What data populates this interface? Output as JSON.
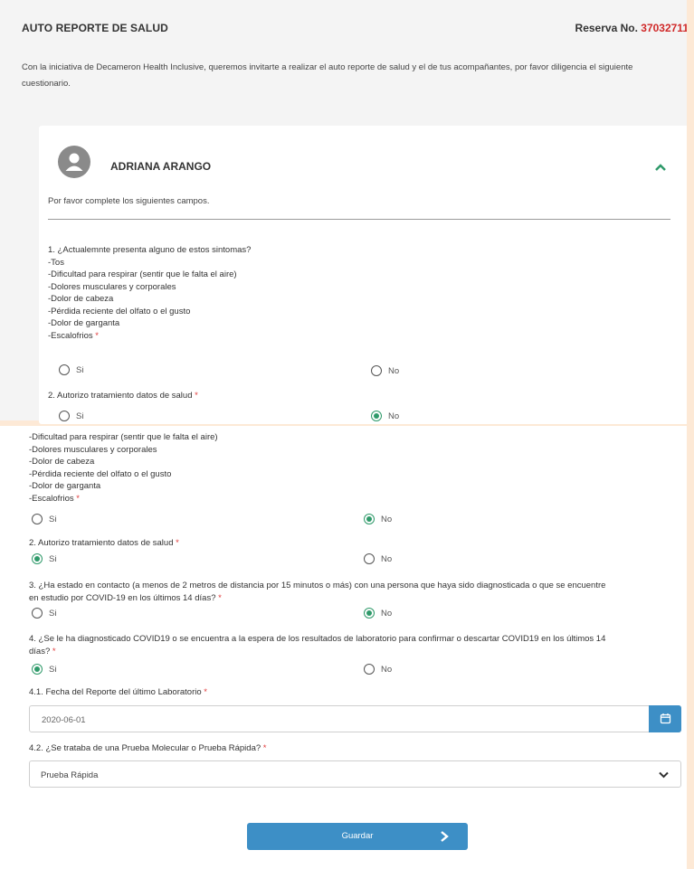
{
  "header": {
    "title": "AUTO REPORTE DE SALUD",
    "reserva_label": "Reserva No.",
    "reserva_number": "37032711"
  },
  "intro": "Con la iniciativa de Decameron Health Inclusive, queremos invitarte a realizar el auto reporte de salud y el de tus acompañantes, por favor diligencia el siguiente cuestionario.",
  "card": {
    "name": "ADRIANA ARANGO",
    "subtitle": "Por favor complete los siguientes campos.",
    "q1_lines": [
      "1. ¿Actualemnte presenta alguno de estos sintomas?",
      "-Tos",
      "-Dificultad para respirar (sentir que le falta el aire)",
      "-Dolores musculares y corporales",
      "-Dolor de cabeza",
      "-Pérdida reciente del olfato o el gusto",
      "-Dolor de garganta"
    ],
    "q1_last": "-Escalofrios",
    "q2": "2. Autorizo tratamiento datos de salud",
    "opt_si": "Si",
    "opt_no": "No"
  },
  "lower": {
    "q1_lines": [
      "-Dificultad para respirar (sentir que le falta el aire)",
      "-Dolores musculares y corporales",
      "-Dolor de cabeza",
      "-Pérdida reciente del olfato o el gusto",
      "-Dolor de garganta"
    ],
    "q1_last": "-Escalofrios",
    "q2": "2. Autorizo tratamiento datos de salud",
    "q3_line1": "3. ¿Ha estado en contacto (a menos de 2 metros de distancia por 15 minutos o más) con una persona que haya sido diagnosticada o que se encuentre",
    "q3_line2": "en estudio por COVID-19 en los últimos 14 días?",
    "q4_line1": "4. ¿Se le ha diagnosticado COVID19 o se encuentra a la espera de los resultados de laboratorio para confirmar o descartar COVID19 en los últimos 14",
    "q4_line2": "días?",
    "q41": "4.1. Fecha del Reporte del último Laboratorio",
    "q41_value": "2020-06-01",
    "q42": "4.2. ¿Se trataba de una Prueba Molecular o Prueba Rápida?",
    "q42_value": "Prueba Rápida",
    "save_label": "Guardar",
    "opt_si": "Si",
    "opt_no": "No"
  },
  "colors": {
    "accent": "#3d8fc6",
    "radio_on": "#2f9a6a",
    "required": "#e03b3b",
    "reserva": "#d02a2a"
  }
}
